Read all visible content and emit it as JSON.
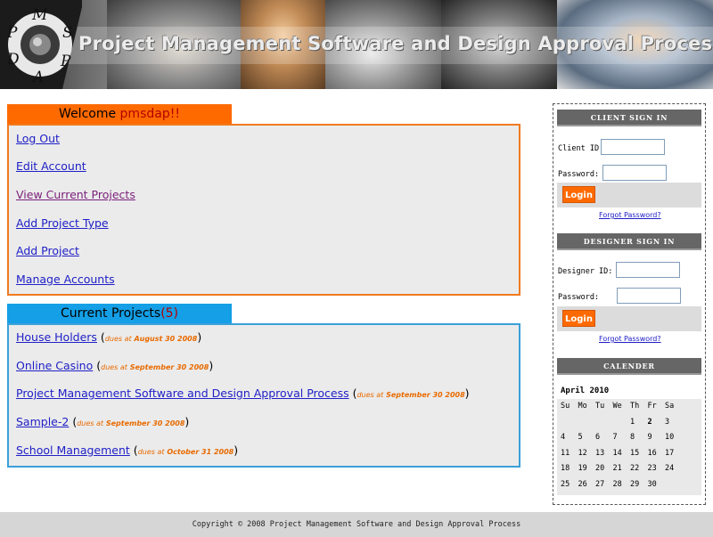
{
  "header": {
    "title": "Project Management Software and Design Approval Process",
    "logo_letters": [
      "M",
      "P",
      "S",
      "D",
      "P",
      "A"
    ]
  },
  "welcome": {
    "label": "Welcome ",
    "user": "pmsdap!!",
    "links": [
      "Log Out",
      "Edit Account",
      "View Current Projects",
      "Add Project Type",
      "Add Project",
      "Manage Accounts"
    ]
  },
  "projects": {
    "label": "Current Projects",
    "count": "(5)",
    "items": [
      {
        "name": "House Holders",
        "due_label": "dues at",
        "due_date": "August 30 2008"
      },
      {
        "name": "Online Casino",
        "due_label": "dues at",
        "due_date": "September 30 2008"
      },
      {
        "name": "Project Management Software and Design Approval Process",
        "due_label": "dues at",
        "due_date": "September 30 2008"
      },
      {
        "name": "Sample-2",
        "due_label": "dues at",
        "due_date": "September 30 2008"
      },
      {
        "name": "School Management",
        "due_label": "dues at",
        "due_date": "October 31 2008"
      }
    ]
  },
  "client_signin": {
    "heading": "CLIENT SIGN IN",
    "id_label": "Client ID:",
    "password_label": "Password:",
    "login": "Login",
    "forgot": "Forgot Password?"
  },
  "designer_signin": {
    "heading": "DESIGNER SIGN IN",
    "id_label": "Designer ID:",
    "password_label": "Password:",
    "login": "Login",
    "forgot": "Forgot Password?"
  },
  "calendar": {
    "heading": "CALENDER",
    "month": "April 2010",
    "weekdays": [
      "Su",
      "Mo",
      "Tu",
      "We",
      "Th",
      "Fr",
      "Sa"
    ],
    "days": [
      "",
      "",
      "",
      "",
      "1",
      "2",
      "3",
      "4",
      "5",
      "6",
      "7",
      "8",
      "9",
      "10",
      "11",
      "12",
      "13",
      "14",
      "15",
      "16",
      "17",
      "18",
      "19",
      "20",
      "21",
      "22",
      "23",
      "24",
      "25",
      "26",
      "27",
      "28",
      "29",
      "30",
      ""
    ],
    "today": "2"
  },
  "footer": {
    "text": "Copyright © 2008 Project Management Software and Design Approval Process"
  },
  "colors": {
    "welcome_accent": "#ff6a00",
    "projects_accent": "#149fe6",
    "login_button": "#ff6a00",
    "panel_head": "#666666"
  }
}
